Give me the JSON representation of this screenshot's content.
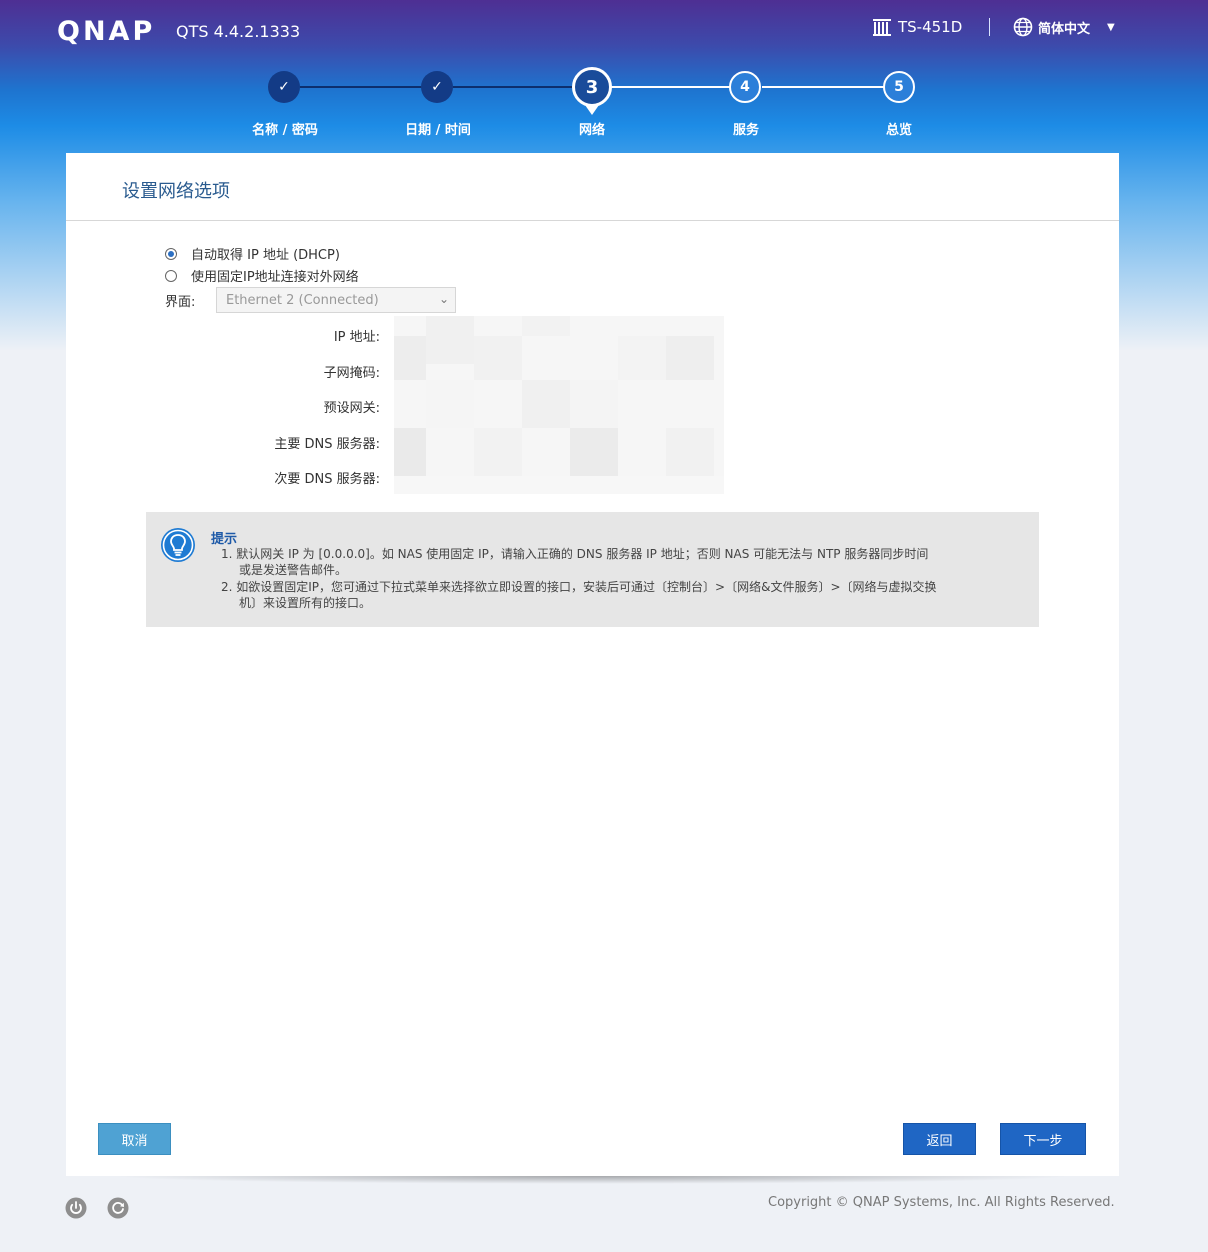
{
  "header": {
    "logo": "QNAP",
    "version": "QTS 4.4.2.1333",
    "device": "TS-451D",
    "language": "简体中文"
  },
  "steps": [
    {
      "number": "✓",
      "label": "名称 / 密码",
      "state": "done"
    },
    {
      "number": "✓",
      "label": "日期 / 时间",
      "state": "done"
    },
    {
      "number": "3",
      "label": "网络",
      "state": "current"
    },
    {
      "number": "4",
      "label": "服务",
      "state": "todo"
    },
    {
      "number": "5",
      "label": "总览",
      "state": "todo"
    }
  ],
  "panel": {
    "title": "设置网络选项",
    "radio_dhcp": "自动取得 IP 地址 (DHCP)",
    "radio_static": "使用固定IP地址连接对外网络",
    "interface_label": "界面:",
    "interface_value": "Ethernet 2 (Connected)",
    "fields": {
      "ip": "IP 地址:",
      "subnet": "子网掩码:",
      "gateway": "预设网关:",
      "dns1": "主要 DNS 服务器:",
      "dns2": "次要 DNS 服务器:"
    }
  },
  "tip": {
    "title": "提示",
    "line1a": "1. 默认网关 IP 为 [0.0.0.0]。如 NAS 使用固定 IP，请输入正确的 DNS 服务器 IP 地址；否则 NAS 可能无法与 NTP 服务器同步时间",
    "line1b": "或是发送警告邮件。",
    "line2a": "2. 如欲设置固定IP，您可通过下拉式菜单来选择欲立即设置的接口，安装后可通过〔控制台〕>〔网络&文件服务〕>〔网络与虚拟交换",
    "line2b": "机〕来设置所有的接口。"
  },
  "buttons": {
    "cancel": "取消",
    "back": "返回",
    "next": "下一步"
  },
  "footer": {
    "copyright": "Copyright © QNAP Systems, Inc. All Rights Reserved."
  },
  "colors": {
    "accent": "#1f66c4",
    "cancel": "#4fa2d3",
    "title": "#2a5b8f"
  }
}
